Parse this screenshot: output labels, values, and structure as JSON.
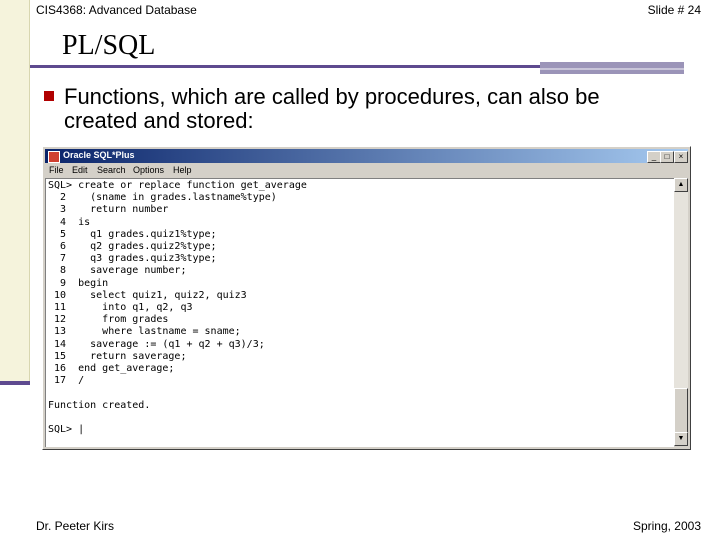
{
  "header": {
    "course": "CIS4368: Advanced Database",
    "slide": "Slide # 24"
  },
  "title": "PL/SQL",
  "bullet": "Functions, which are called by procedures, can also be created and stored:",
  "window": {
    "title": "Oracle SQL*Plus",
    "buttons": {
      "minimize": "_",
      "maximize": "□",
      "close": "×"
    },
    "menu": [
      "File",
      "Edit",
      "Search",
      "Options",
      "Help"
    ],
    "lines": [
      "SQL> create or replace function get_average",
      "  2    (sname in grades.lastname%type)",
      "  3    return number",
      "  4  is",
      "  5    q1 grades.quiz1%type;",
      "  6    q2 grades.quiz2%type;",
      "  7    q3 grades.quiz3%type;",
      "  8    saverage number;",
      "  9  begin",
      " 10    select quiz1, quiz2, quiz3",
      " 11      into q1, q2, q3",
      " 12      from grades",
      " 13      where lastname = sname;",
      " 14    saverage := (q1 + q2 + q3)/3;",
      " 15    return saverage;",
      " 16  end get_average;",
      " 17  /",
      "",
      "Function created.",
      "",
      "SQL> |"
    ]
  },
  "footer": {
    "author": "Dr. Peeter Kirs",
    "term": "Spring, 2003"
  },
  "colors": {
    "accent": "#5e4a8f",
    "bullet": "#b00000",
    "titlebar": "#0a246a"
  }
}
